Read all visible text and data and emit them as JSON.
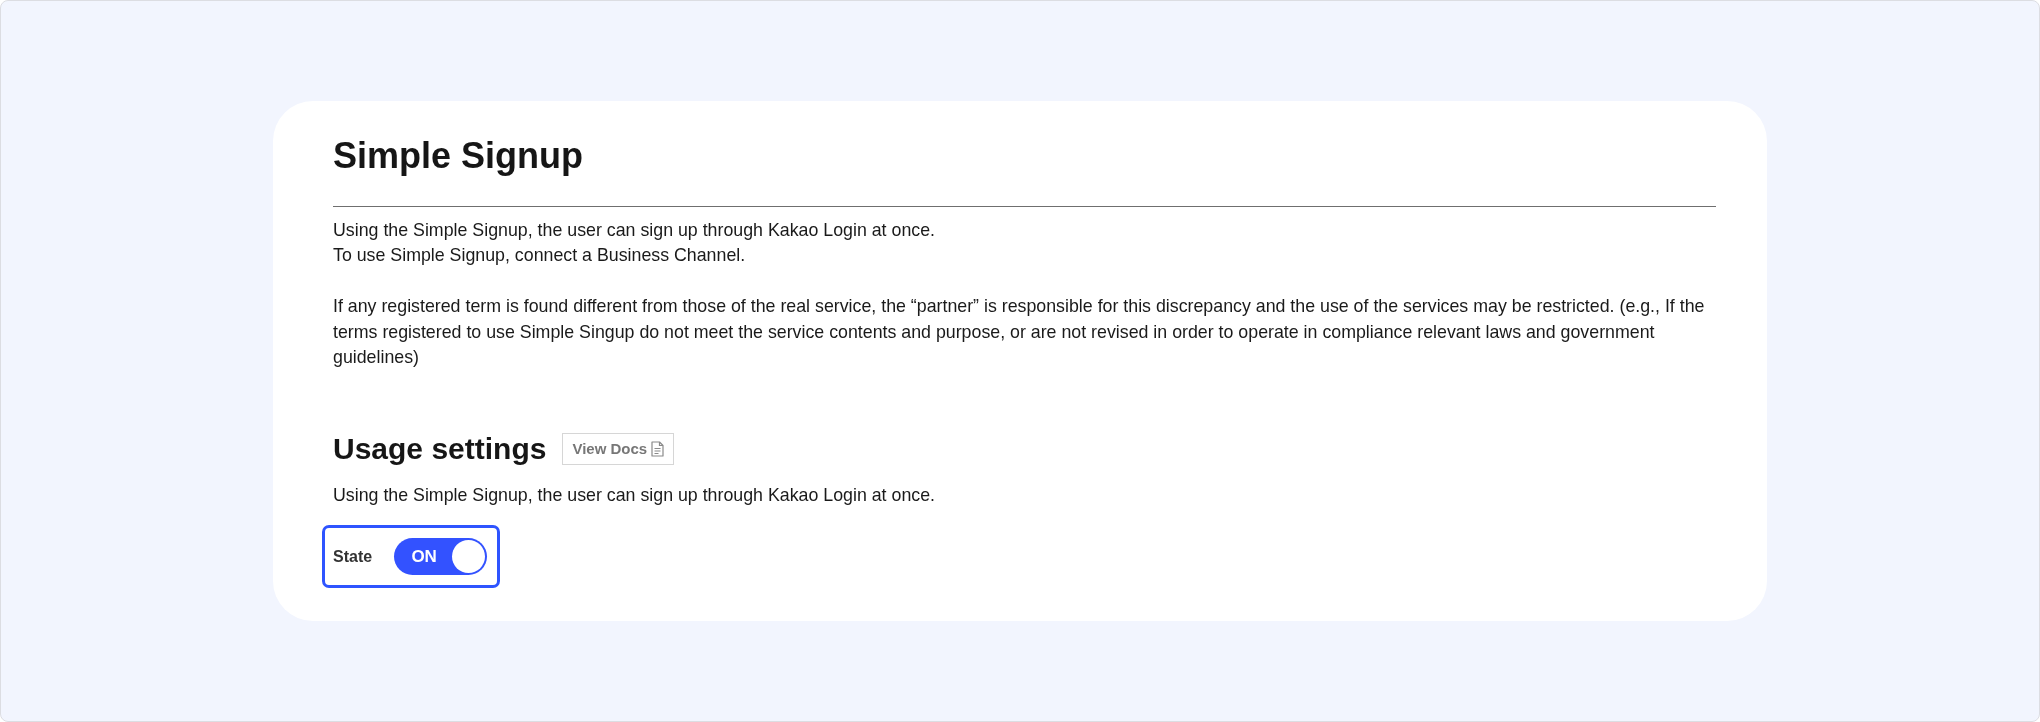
{
  "page": {
    "title": "Simple Signup",
    "intro_lines": [
      "Using the Simple Signup, the user can sign up through Kakao Login at once.",
      "To use Simple Signup, connect a Business Channel."
    ],
    "notice": "If any registered term is found different from those of the real service, the “partner” is responsible for this discrepancy and the use of the services may be restricted. (e.g., If the terms registered to use Simple Singup do not meet the service contents and purpose, or are not revised in order to operate in compliance relevant laws and government guidelines)"
  },
  "usage_settings": {
    "title": "Usage settings",
    "docs_button": {
      "label": "View Docs"
    },
    "description": "Using the Simple Signup, the user can sign up through Kakao Login at once.",
    "state": {
      "label": "State",
      "highlighted": true,
      "toggle": {
        "on": true,
        "text": "ON"
      }
    }
  }
}
